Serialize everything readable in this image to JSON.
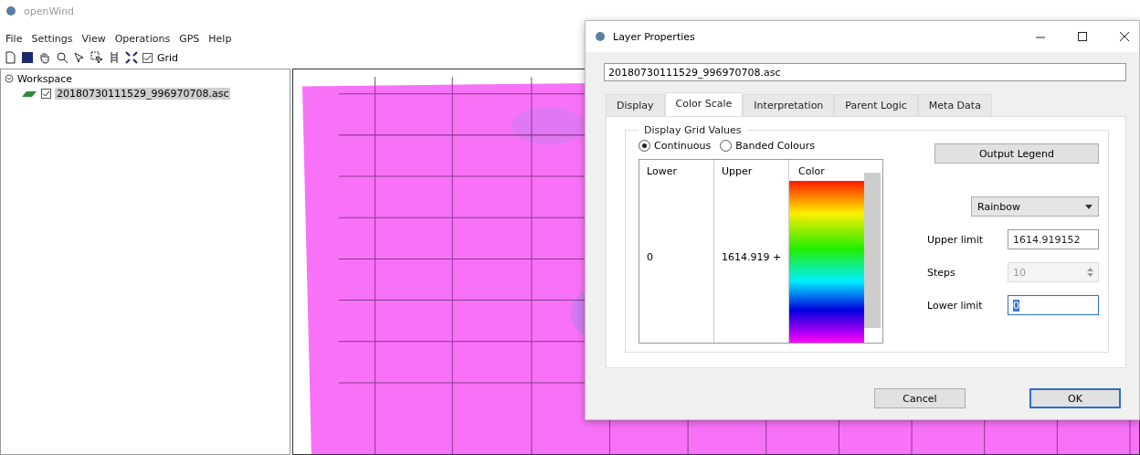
{
  "window": {
    "title": "openWind"
  },
  "menu": [
    "File",
    "Settings",
    "View",
    "Operations",
    "GPS",
    "Help"
  ],
  "toolbar": {
    "grid_checkbox": {
      "label": "Grid",
      "checked": true
    }
  },
  "workspace": {
    "label": "Workspace",
    "expanded": true,
    "children": [
      {
        "label": "20180730111529_996970708.asc",
        "checked": true,
        "selected": true
      }
    ]
  },
  "dialog": {
    "title": "Layer Properties",
    "layer_name": "20180730111529_996970708.asc",
    "tabs": [
      {
        "label": "Display",
        "selected": false
      },
      {
        "label": "Color Scale",
        "selected": true
      },
      {
        "label": "Interpretation",
        "selected": false
      },
      {
        "label": "Parent Logic",
        "selected": false
      },
      {
        "label": "Meta Data",
        "selected": false
      }
    ],
    "group_title": "Display Grid Values",
    "modes": [
      {
        "label": "Continuous",
        "selected": true
      },
      {
        "label": "Banded Colours",
        "selected": false
      }
    ],
    "table": {
      "columns": [
        "Lower",
        "Upper",
        "Color"
      ],
      "rows": [
        {
          "lower": "0",
          "upper": "1614.919 +"
        }
      ]
    },
    "output_legend": "Output Legend",
    "scheme": "Rainbow",
    "upper_limit": {
      "label": "Upper limit",
      "value": "1614.919152"
    },
    "steps": {
      "label": "Steps",
      "value": "10",
      "disabled": true
    },
    "lower_limit": {
      "label": "Lower limit",
      "value": "0",
      "focused": true
    },
    "buttons": [
      {
        "label": "Cancel",
        "default": false
      },
      {
        "label": "OK",
        "default": true
      }
    ]
  }
}
